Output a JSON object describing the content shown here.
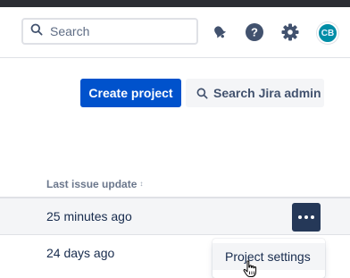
{
  "navbar": {
    "search": {
      "placeholder": "Search",
      "value": ""
    },
    "icons": [
      "notifications-icon",
      "help-icon",
      "settings-icon"
    ],
    "avatar_initials": "CB"
  },
  "actions": {
    "create_project": "Create project",
    "search_admin": "Search Jira admin"
  },
  "table": {
    "column_header": "Last issue update",
    "sort_indicator": "↕",
    "rows": [
      {
        "last_update": "25 minutes ago"
      },
      {
        "last_update": "24 days ago"
      }
    ]
  },
  "dropdown": {
    "items": [
      "Project settings"
    ]
  },
  "colors": {
    "primary": "#0052cc",
    "more_button": "#253858",
    "avatar": "#008da6",
    "row_hover": "#f4f5f7"
  }
}
